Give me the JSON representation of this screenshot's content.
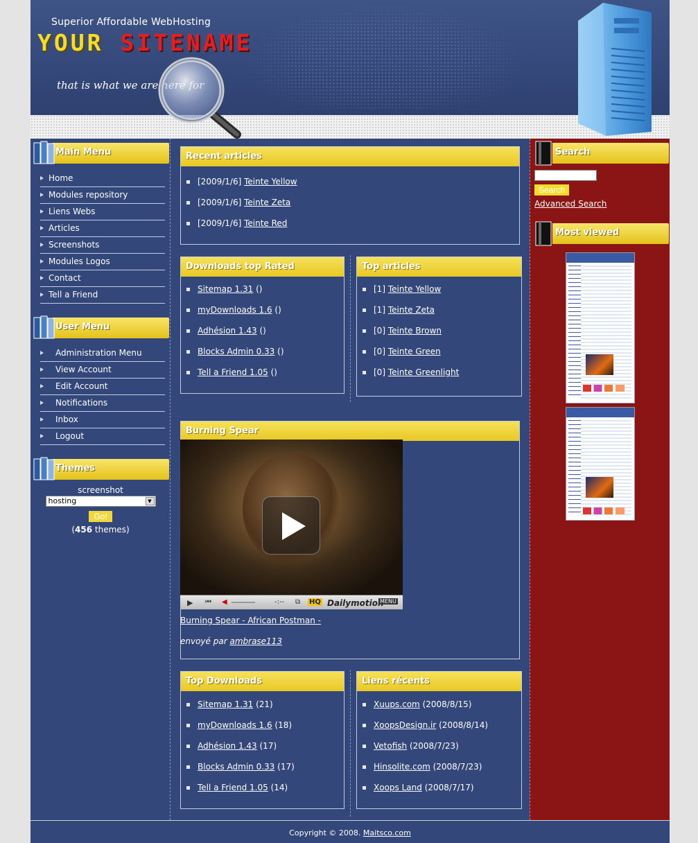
{
  "header": {
    "tagline": "Superior Affordable WebHosting",
    "title_part1": "YOUR",
    "title_part2": "SITENAME",
    "slogan": "that is what we are here for"
  },
  "left": {
    "main_menu": {
      "title": "Main Menu",
      "items": [
        "Home",
        "Modules repository",
        "Liens Webs",
        "Articles",
        "Screenshots",
        "Modules Logos",
        "Contact",
        "Tell a Friend"
      ]
    },
    "user_menu": {
      "title": "User Menu",
      "items": [
        "Administration Menu",
        "View Account",
        "Edit Account",
        "Notifications",
        "Inbox",
        "Logout"
      ]
    },
    "themes": {
      "title": "Themes",
      "label": "screenshot",
      "selected": "hosting",
      "go_label": "Go!",
      "count_open": "(",
      "count": "456",
      "count_close": " themes)"
    }
  },
  "center": {
    "recent_articles": {
      "title": "Recent articles",
      "items": [
        {
          "date": "[2009/1/6]",
          "title": "Teinte Yellow"
        },
        {
          "date": "[2009/1/6]",
          "title": "Teinte Zeta"
        },
        {
          "date": "[2009/1/6]",
          "title": "Teinte Red"
        }
      ]
    },
    "downloads_top_rated": {
      "title": "Downloads top Rated",
      "items": [
        {
          "name": "Sitemap 1.31",
          "extra": "()"
        },
        {
          "name": "myDownloads 1.6",
          "extra": "()"
        },
        {
          "name": "Adhésion 1.43",
          "extra": "()"
        },
        {
          "name": "Blocks Admin 0.33",
          "extra": "()"
        },
        {
          "name": "Tell a Friend 1.05",
          "extra": "()"
        }
      ]
    },
    "top_articles": {
      "title": "Top articles",
      "items": [
        {
          "count": "[1]",
          "title": "Teinte Yellow"
        },
        {
          "count": "[1]",
          "title": "Teinte Zeta"
        },
        {
          "count": "[0]",
          "title": "Teinte Brown"
        },
        {
          "count": "[0]",
          "title": "Teinte Green"
        },
        {
          "count": "[0]",
          "title": "Teinte Greenlight"
        }
      ]
    },
    "video_block": {
      "title": "Burning Spear",
      "player": {
        "time": "-:--",
        "hq": "HQ",
        "brand": "Dailymotion",
        "menu": "MENU"
      },
      "video_link": "Burning Spear - African Postman -",
      "sent_by_label": "envoyé par",
      "sent_by_user": "ambrase113"
    },
    "top_downloads": {
      "title": "Top Downloads",
      "items": [
        {
          "name": "Sitemap 1.31",
          "extra": "(21)"
        },
        {
          "name": "myDownloads 1.6",
          "extra": "(18)"
        },
        {
          "name": "Adhésion 1.43",
          "extra": "(17)"
        },
        {
          "name": "Blocks Admin 0.33",
          "extra": "(17)"
        },
        {
          "name": "Tell a Friend 1.05",
          "extra": "(14)"
        }
      ]
    },
    "recent_links": {
      "title": "Liens récents",
      "items": [
        {
          "name": "Xuups.com",
          "extra": "(2008/8/15)"
        },
        {
          "name": "XoopsDesign.ir",
          "extra": "(2008/8/14)"
        },
        {
          "name": "Vetofish",
          "extra": "(2008/7/23)"
        },
        {
          "name": "Hinsolite.com",
          "extra": "(2008/7/23)"
        },
        {
          "name": "Xoops Land",
          "extra": "(2008/7/17)"
        }
      ]
    }
  },
  "right": {
    "search": {
      "title": "Search",
      "button": "Search",
      "advanced": "Advanced Search",
      "value": ""
    },
    "most_viewed": {
      "title": "Most viewed"
    }
  },
  "footer": {
    "copyright": "Copyright © 2008.",
    "link": "Maitsco.com"
  },
  "colors": {
    "accent_yellow": "#f3dc2c",
    "panel_blue": "#34477a",
    "right_red": "#8b1414",
    "title_red": "#e02020"
  }
}
